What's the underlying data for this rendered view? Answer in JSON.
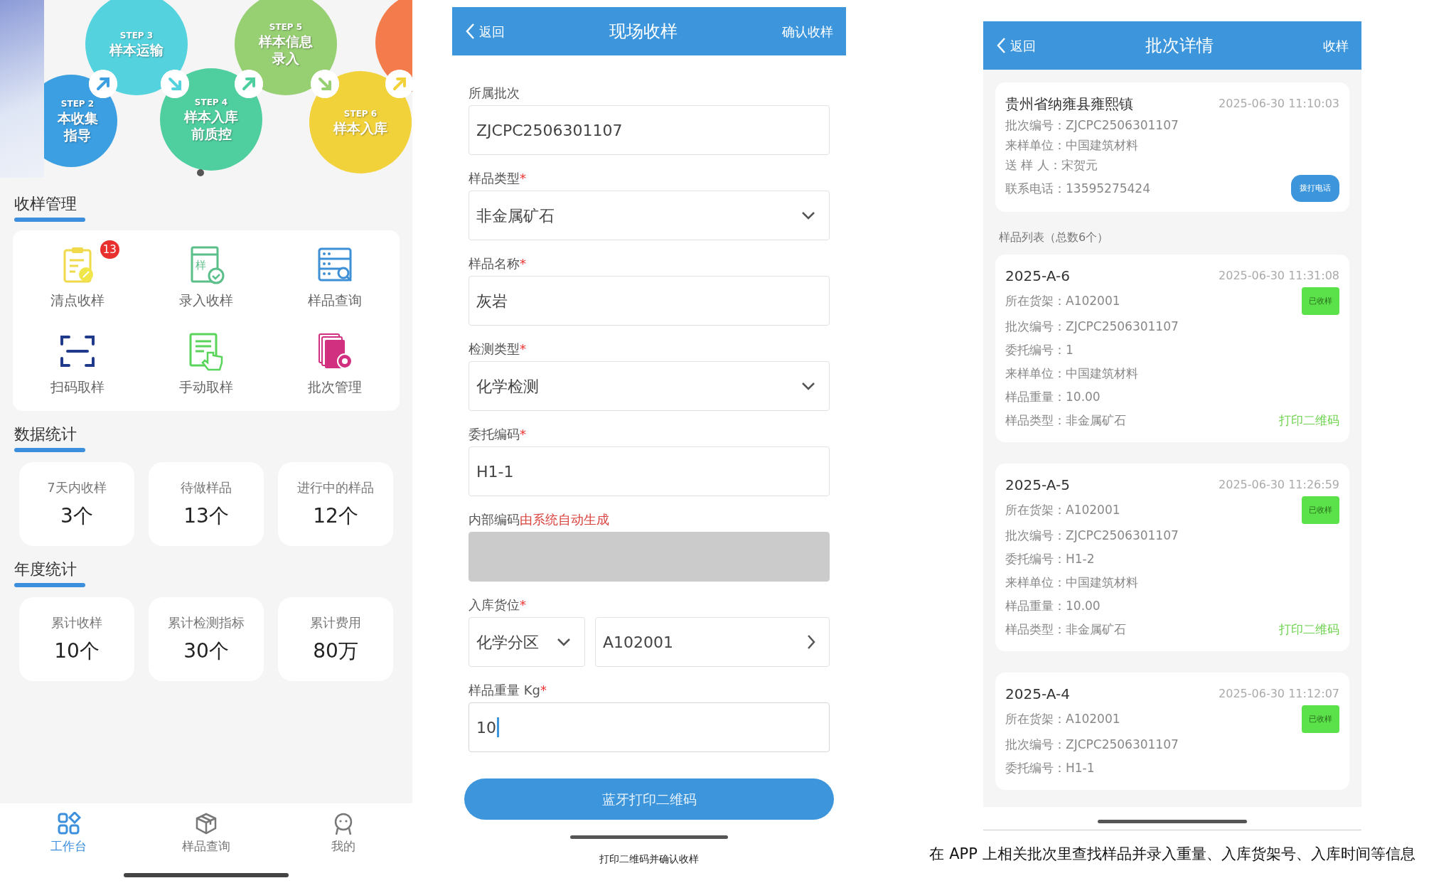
{
  "home": {
    "banner": {
      "steps": [
        {
          "step": "STEP 2",
          "title_lines": [
            "本收集",
            "指导"
          ],
          "color": "#3c9fe2"
        },
        {
          "step": "STEP 3",
          "title_lines": [
            "样本运输"
          ],
          "color": "#54d3df"
        },
        {
          "step": "STEP 4",
          "title_lines": [
            "样本入库",
            "前质控"
          ],
          "color": "#4fcf9f"
        },
        {
          "step": "STEP 5",
          "title_lines": [
            "样本信息",
            "录入"
          ],
          "color": "#97cf73"
        },
        {
          "step": "STEP 6",
          "title_lines": [
            "样本入库"
          ],
          "color": "#f2d23b"
        },
        {
          "color": "#f47c4c"
        }
      ]
    },
    "management": {
      "title": "收样管理",
      "items": [
        {
          "label": "清点收样",
          "badge": "13"
        },
        {
          "label": "录入收样",
          "icon_text": "样"
        },
        {
          "label": "样品查询"
        },
        {
          "label": "扫码取样"
        },
        {
          "label": "手动取样"
        },
        {
          "label": "批次管理"
        }
      ]
    },
    "stats": {
      "title": "数据统计",
      "cards": [
        {
          "label": "7天内收样",
          "value": "3个"
        },
        {
          "label": "待做样品",
          "value": "13个"
        },
        {
          "label": "进行中的样品",
          "value": "12个"
        }
      ]
    },
    "annual": {
      "title": "年度统计",
      "cards": [
        {
          "label": "累计收样",
          "value": "10个"
        },
        {
          "label": "累计检测指标",
          "value": "30个"
        },
        {
          "label": "累计费用",
          "value": "80万"
        }
      ]
    },
    "tab_bar": [
      {
        "label": "工作台",
        "selected": true
      },
      {
        "label": "样品查询",
        "selected": false
      },
      {
        "label": "我的",
        "selected": false
      }
    ]
  },
  "intake_form": {
    "back": "返回",
    "title": "现场收样",
    "action": "确认收样",
    "fields": [
      {
        "kind": "input",
        "label": "所属批次",
        "value": "ZJCPC2506301107",
        "focused": false
      },
      {
        "kind": "select",
        "label": "样品类型",
        "mark": "*",
        "value": "非金属矿石"
      },
      {
        "kind": "input",
        "label": "样品名称",
        "mark": "*",
        "value": "灰岩",
        "focused": false
      },
      {
        "kind": "select",
        "label": "检测类型",
        "mark": "*",
        "value": "化学检测"
      },
      {
        "kind": "input",
        "label": "委托编码",
        "mark": "*",
        "value": "H1-1",
        "focused": false
      },
      {
        "kind": "disabled",
        "label": "内部编码",
        "note": "由系统自动生成"
      },
      {
        "kind": "location",
        "label": "入库货位",
        "mark": "*",
        "zone": "化学分区",
        "shelf": "A102001"
      },
      {
        "kind": "input",
        "label": "样品重量 Kg",
        "mark": "*",
        "value": "10",
        "focused": true
      }
    ],
    "button": "蓝牙打印二维码",
    "caption": "打印二维码并确认收样"
  },
  "batch_detail": {
    "back": "返回",
    "title": "批次详情",
    "action": "收样",
    "batch": {
      "title": "贵州省纳雍县雍熙镇",
      "time": "2025-06-30 11:10:03",
      "call_button": "拨打电话",
      "rows": [
        {
          "label": "批次编号：",
          "value": "ZJCPC2506301107"
        },
        {
          "label": "来样单位：",
          "value": "中国建筑材料"
        },
        {
          "label": "送 样 人：",
          "value": "宋贺元"
        },
        {
          "label": "联系电话：",
          "value": "13595275424"
        }
      ]
    },
    "list_title": "样品列表（总数6个）",
    "samples": [
      {
        "code": "2025-A-6",
        "time": "2025-06-30 11:31:08",
        "badge": "已收样",
        "print_link": "打印二维码",
        "rows": [
          {
            "label": "所在货架：",
            "value": "A102001"
          },
          {
            "label": "批次编号：",
            "value": "ZJCPC2506301107"
          },
          {
            "label": "委托编号：",
            "value": "1"
          },
          {
            "label": "来样单位：",
            "value": "中国建筑材料"
          },
          {
            "label": "样品重量：",
            "value": "10.00"
          },
          {
            "label": "样品类型：",
            "value": "非金属矿石"
          }
        ]
      },
      {
        "code": "2025-A-5",
        "time": "2025-06-30 11:26:59",
        "badge": "已收样",
        "print_link": "打印二维码",
        "rows": [
          {
            "label": "所在货架：",
            "value": "A102001"
          },
          {
            "label": "批次编号：",
            "value": "ZJCPC2506301107"
          },
          {
            "label": "委托编号：",
            "value": "H1-2"
          },
          {
            "label": "来样单位：",
            "value": "中国建筑材料"
          },
          {
            "label": "样品重量：",
            "value": "10.00"
          },
          {
            "label": "样品类型：",
            "value": "非金属矿石"
          }
        ]
      },
      {
        "code": "2025-A-4",
        "time": "2025-06-30 11:12:07",
        "badge": "已收样",
        "rows": [
          {
            "label": "所在货架：",
            "value": "A102001"
          },
          {
            "label": "批次编号：",
            "value": "ZJCPC2506301107"
          },
          {
            "label": "委托编号：",
            "value": "H1-1"
          }
        ]
      }
    ],
    "caption": "在 APP 上相关批次里查找样品并录入重量、入库货架号、入库时间等信息"
  }
}
